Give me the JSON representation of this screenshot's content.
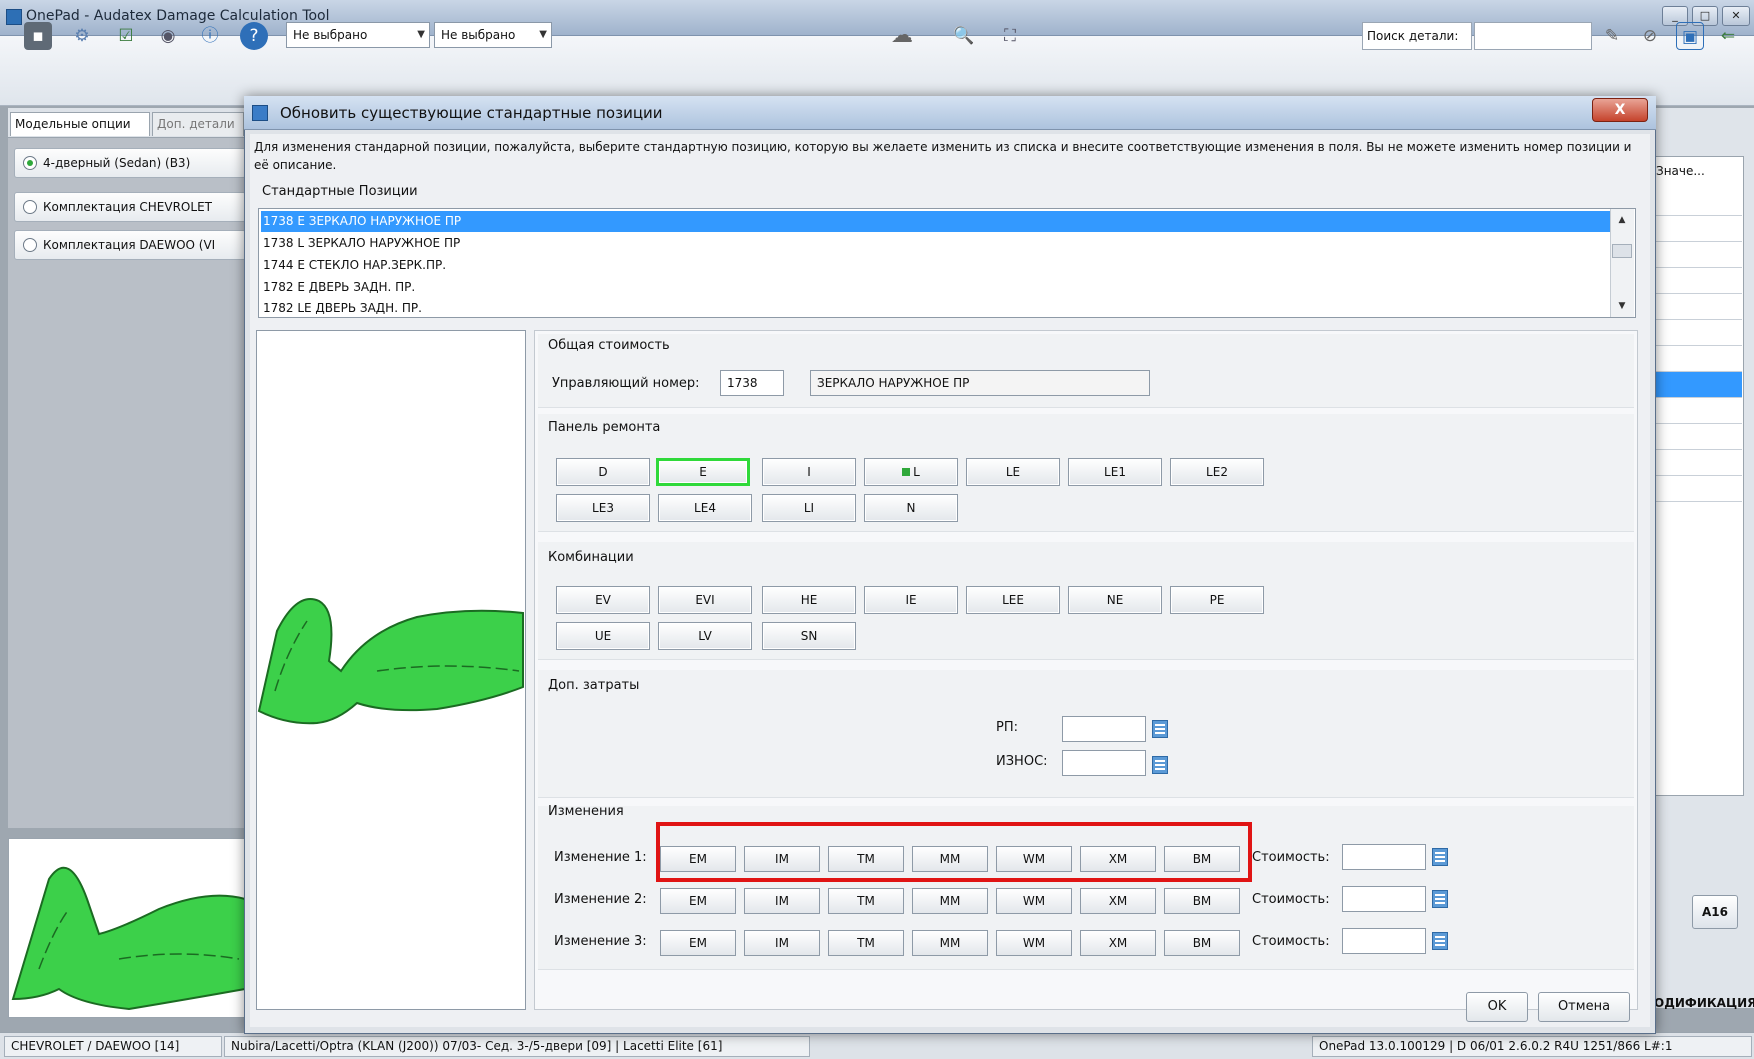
{
  "app": {
    "title": "OnePad - Audatex Damage Calculation Tool",
    "toolbar": {
      "combo1": "Не выбрано",
      "combo2": "Не выбрано",
      "search_label": "Поиск детали:",
      "search_value": ""
    },
    "left_pane": {
      "tabs": [
        "Модельные опции",
        "Доп. детали"
      ],
      "options": [
        {
          "label": "4-дверный (Sedan) (B3)",
          "selected": true
        },
        {
          "label": "Комплектация CHEVROLET",
          "selected": false
        },
        {
          "label": "Комплектация DAEWOO (VI",
          "selected": false
        }
      ]
    },
    "right_pane": {
      "header": "Значе...",
      "button": "A16",
      "bottom_label": "ОДИФИКАЦИЯ"
    },
    "statusbar": {
      "cells": [
        "CHEVROLET / DAEWOO [14]",
        "Nubira/Lacetti/Optra (KLAN (J200)) 07/03- Сед. 3-/5-двери [09] | Lacetti Elite [61]",
        "OnePad 13.0.100129 | D 06/01 2.6.0.2 R4U 1251/866 L#:1"
      ]
    }
  },
  "dialog": {
    "title": "Обновить существующие стандартные позиции",
    "close_label": "X",
    "instructions": "Для изменения стандарной позиции, пожалуйста, выберите стандартную позицию, которую вы желаете изменить из списка и внесите соответствующие изменения в поля. Вы не можете изменить номер позиции и её описание.",
    "positions_label": "Стандартные Позиции",
    "positions": [
      {
        "text": "1738 E ЗЕРКАЛО НАРУЖНОЕ ПР",
        "selected": true
      },
      {
        "text": "1738 L ЗЕРКАЛО НАРУЖНОЕ ПР",
        "selected": false
      },
      {
        "text": "1744 E СТЕКЛО НАР.ЗЕРК.ПР.",
        "selected": false
      },
      {
        "text": "1782 E ДВЕРЬ ЗАДН. ПР.",
        "selected": false
      },
      {
        "text": "1782 LE ДВЕРЬ ЗАДН. ПР.",
        "selected": false
      }
    ],
    "total_cost": {
      "section": "Общая стоимость",
      "control_label": "Управляющий номер:",
      "control_number": "1738",
      "description": "ЗЕРКАЛО НАРУЖНОЕ ПР"
    },
    "repair_panel": {
      "section": "Панель ремонта",
      "row1": [
        "D",
        "E",
        "I",
        "L",
        "LE",
        "LE1",
        "LE2"
      ],
      "row2": [
        "LE3",
        "LE4",
        "LI",
        "N"
      ],
      "active": "E",
      "marked": "L"
    },
    "combinations": {
      "section": "Комбинации",
      "row1": [
        "EV",
        "EVI",
        "HE",
        "IE",
        "LEE",
        "NE",
        "PE"
      ],
      "row2": [
        "UE",
        "LV",
        "SN"
      ]
    },
    "extra_costs": {
      "section": "Доп. затраты",
      "rp_label": "РП:",
      "wear_label": "ИЗНОС:",
      "rp_value": "",
      "wear_value": ""
    },
    "changes": {
      "section": "Изменения",
      "buttons": [
        "EM",
        "IM",
        "TM",
        "MM",
        "WM",
        "XM",
        "BM"
      ],
      "cost_label": "Стоимость:",
      "rows": [
        {
          "label": "Изменение 1:",
          "cost": ""
        },
        {
          "label": "Изменение 2:",
          "cost": ""
        },
        {
          "label": "Изменение 3:",
          "cost": ""
        }
      ]
    },
    "ok_label": "OK",
    "cancel_label": "Отмена"
  },
  "colors": {
    "selection": "#3399ff",
    "highlight_green": "#2fd93a",
    "part_green": "#3cd04a",
    "annotation_red": "#e01414"
  },
  "icons": [
    "save-icon",
    "settings-icon",
    "checklist-icon",
    "eye-icon",
    "info-icon",
    "help-icon",
    "car-icon",
    "zoom-icon",
    "fit-icon",
    "calculator-icon"
  ]
}
